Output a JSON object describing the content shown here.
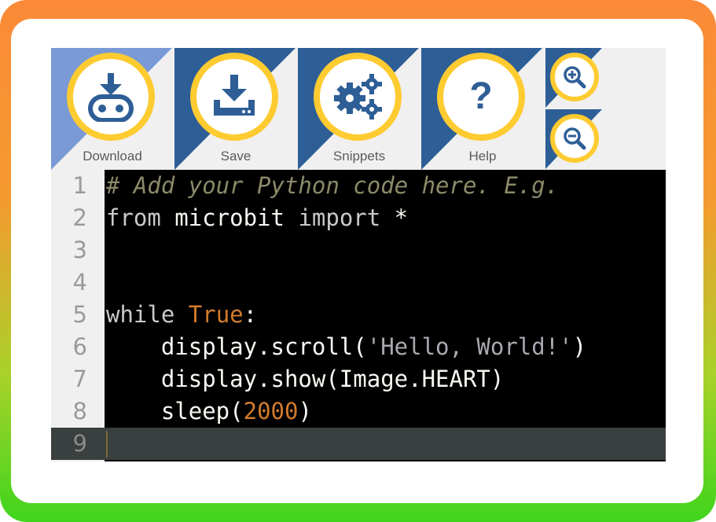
{
  "toolbar": {
    "download_label": "Download",
    "save_label": "Save",
    "snippets_label": "Snippets",
    "help_label": "Help",
    "help_symbol": "?"
  },
  "colors": {
    "frame_top": "#fb8a38",
    "frame_bottom": "#3fd51c",
    "button_ring": "#fecb31",
    "button_accent": "#2e5e96",
    "download_accent": "#7a9ad6",
    "toolbar_bg": "#f0f0f0",
    "editor_bg": "#000000"
  },
  "editor": {
    "lines": [
      {
        "num": "1",
        "tokens": [
          {
            "t": "# Add your Python code here. E.g.",
            "k": "comment"
          }
        ]
      },
      {
        "num": "2",
        "tokens": [
          {
            "t": "from",
            "k": "keyword"
          },
          {
            "t": " microbit ",
            "k": "plain"
          },
          {
            "t": "import",
            "k": "keyword"
          },
          {
            "t": " *",
            "k": "plain"
          }
        ]
      },
      {
        "num": "3",
        "tokens": []
      },
      {
        "num": "4",
        "tokens": []
      },
      {
        "num": "5",
        "tokens": [
          {
            "t": "while",
            "k": "keyword"
          },
          {
            "t": " ",
            "k": "plain"
          },
          {
            "t": "True",
            "k": "const"
          },
          {
            "t": ":",
            "k": "plain"
          }
        ]
      },
      {
        "num": "6",
        "tokens": [
          {
            "t": "    display.scroll(",
            "k": "plain"
          },
          {
            "t": "'Hello, World!'",
            "k": "string"
          },
          {
            "t": ")",
            "k": "plain"
          }
        ]
      },
      {
        "num": "7",
        "tokens": [
          {
            "t": "    display.show(Image.HEART)",
            "k": "plain"
          }
        ]
      },
      {
        "num": "8",
        "tokens": [
          {
            "t": "    sleep(",
            "k": "plain"
          },
          {
            "t": "2000",
            "k": "number"
          },
          {
            "t": ")",
            "k": "plain"
          }
        ]
      },
      {
        "num": "9",
        "tokens": [],
        "active": true
      }
    ]
  }
}
